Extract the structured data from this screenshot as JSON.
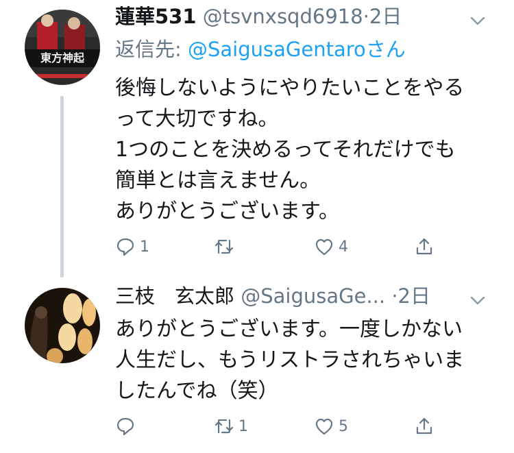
{
  "tweet1": {
    "display_name": "蓮華531",
    "handle": "@tsvnxsqd6918",
    "separator": "·",
    "time": "2日",
    "avatar_text": "東方神起",
    "reply_prefix": "返信先: ",
    "reply_mention": "@SaigusaGentaroさん",
    "lines": [
      "後悔しないようにやりたいことをやる",
      "って大切ですね。",
      "1つのことを決めるってそれだけでも",
      "簡単とは言えません。",
      "ありがとうございます。"
    ],
    "reply_count": "1",
    "retweet_count": "",
    "like_count": "4"
  },
  "tweet2": {
    "display_name": "三枝　玄太郎",
    "handle": "@SaigusaGe...",
    "separator": "·",
    "time": "2日",
    "lines": [
      "ありがとうございます。一度しかない",
      "人生だし、もうリストラされちゃいま",
      "したんでね（笑）"
    ],
    "reply_count": "",
    "retweet_count": "1",
    "like_count": "5"
  },
  "icons": [
    "chevron-down-icon",
    "reply-icon",
    "retweet-icon",
    "like-icon",
    "share-icon"
  ],
  "colors": {
    "text": "#14171a",
    "secondary": "#657786",
    "link": "#1da1f2",
    "thread_line": "#ccd6dd"
  }
}
